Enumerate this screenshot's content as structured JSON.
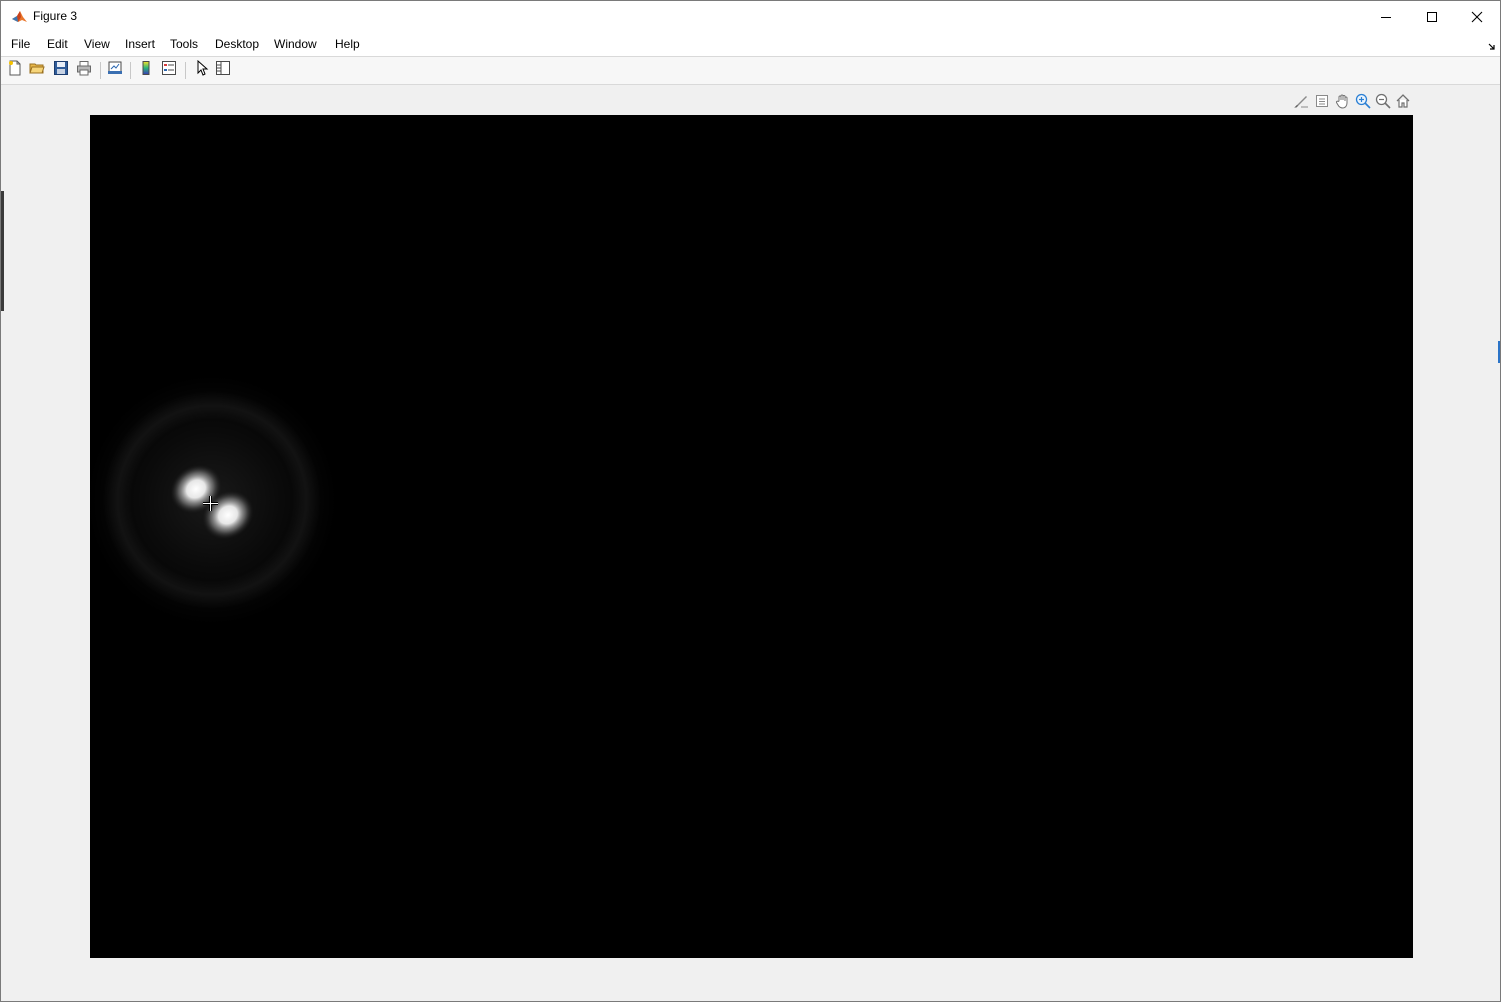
{
  "window": {
    "title": "Figure 3",
    "icon": "matlab-logo-icon",
    "controls": [
      "minimize-icon",
      "maximize-icon",
      "close-icon"
    ]
  },
  "menubar": {
    "items": [
      {
        "label": "File"
      },
      {
        "label": "Edit"
      },
      {
        "label": "View"
      },
      {
        "label": "Insert"
      },
      {
        "label": "Tools"
      },
      {
        "label": "Desktop"
      },
      {
        "label": "Window"
      },
      {
        "label": "Help"
      }
    ],
    "dock_icon": "dock-arrow-icon"
  },
  "toolbar": {
    "buttons": [
      {
        "icon": "new-figure-icon"
      },
      {
        "icon": "open-file-icon"
      },
      {
        "icon": "save-icon"
      },
      {
        "icon": "print-icon"
      },
      {
        "icon": "link-plot-icon"
      },
      {
        "icon": "insert-colorbar-icon"
      },
      {
        "icon": "insert-legend-icon"
      },
      {
        "icon": "edit-plot-pointer-icon"
      },
      {
        "icon": "show-plot-tools-icon"
      }
    ]
  },
  "axes_toolbar": {
    "buttons": [
      {
        "icon": "brush-icon"
      },
      {
        "icon": "data-tips-icon"
      },
      {
        "icon": "pan-hand-icon"
      },
      {
        "icon": "zoom-in-icon",
        "active": true
      },
      {
        "icon": "zoom-out-icon"
      },
      {
        "icon": "restore-view-home-icon"
      }
    ]
  },
  "image": {
    "background_color": "#000000",
    "content": "dual-lobe-intensity-pattern",
    "colormap": "gray"
  },
  "colors": {
    "titlebar_bg": "#ffffff",
    "figure_bg": "#f0f0f0",
    "accent_active": "#2a7fd4"
  }
}
